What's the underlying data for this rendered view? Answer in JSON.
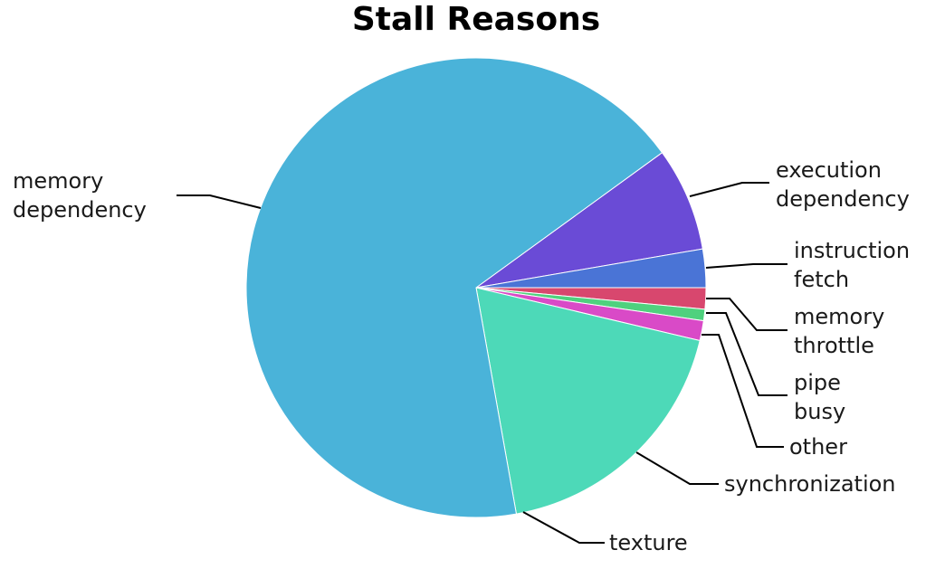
{
  "chart_data": {
    "type": "pie",
    "title": "Stall Reasons",
    "slices": [
      {
        "label": "execution dependency",
        "value": 7.3,
        "color": "#6a4bd6"
      },
      {
        "label": "instruction fetch",
        "value": 2.7,
        "color": "#4a74d6"
      },
      {
        "label": "memory throttle",
        "value": 1.5,
        "color": "#d8476e"
      },
      {
        "label": "pipe busy",
        "value": 0.8,
        "color": "#4fd17e"
      },
      {
        "label": "other",
        "value": 1.4,
        "color": "#d94ac7"
      },
      {
        "label": "synchronization",
        "value": 18.5,
        "color": "#4dd9b8"
      },
      {
        "label": "texture",
        "value": 0.0,
        "color": "#4fa0d8"
      },
      {
        "label": "memory dependency",
        "value": 67.8,
        "color": "#4ab3d9"
      }
    ]
  }
}
